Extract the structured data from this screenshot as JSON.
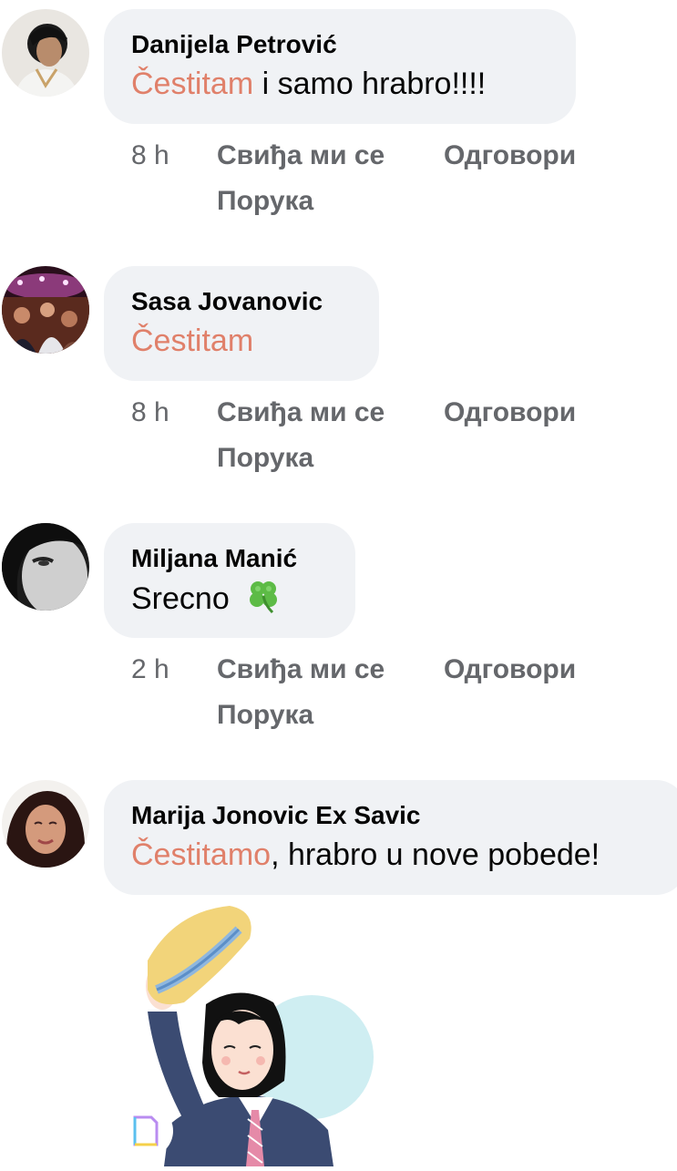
{
  "comments": [
    {
      "author": "Danijela Petrović",
      "keyword": "Čestitam",
      "rest": " i samo hrabro!!!!",
      "time": "8 h",
      "like": "Свиђа ми се",
      "reply": "Одговори",
      "message": "Порука"
    },
    {
      "author": "Sasa Jovanovic",
      "keyword": "Čestitam",
      "rest": "",
      "time": "8 h",
      "like": "Свиђа ми се",
      "reply": "Одговори",
      "message": "Порука"
    },
    {
      "author": "Miljana Manić",
      "keyword": "",
      "rest": "Srecno ",
      "time": "2 h",
      "like": "Свиђа ми се",
      "reply": "Одговори",
      "message": "Порука",
      "emoji": "four-leaf-clover"
    },
    {
      "author": "Marija Jonovic Ex Savic",
      "keyword": "Čestitamo",
      "rest": ", hrabro u nove pobede!",
      "sticker": "girl-with-hat-sticker"
    }
  ],
  "colors": {
    "keyword": "#e0806a",
    "bubble": "#f0f2f5",
    "meta": "#65676b"
  }
}
